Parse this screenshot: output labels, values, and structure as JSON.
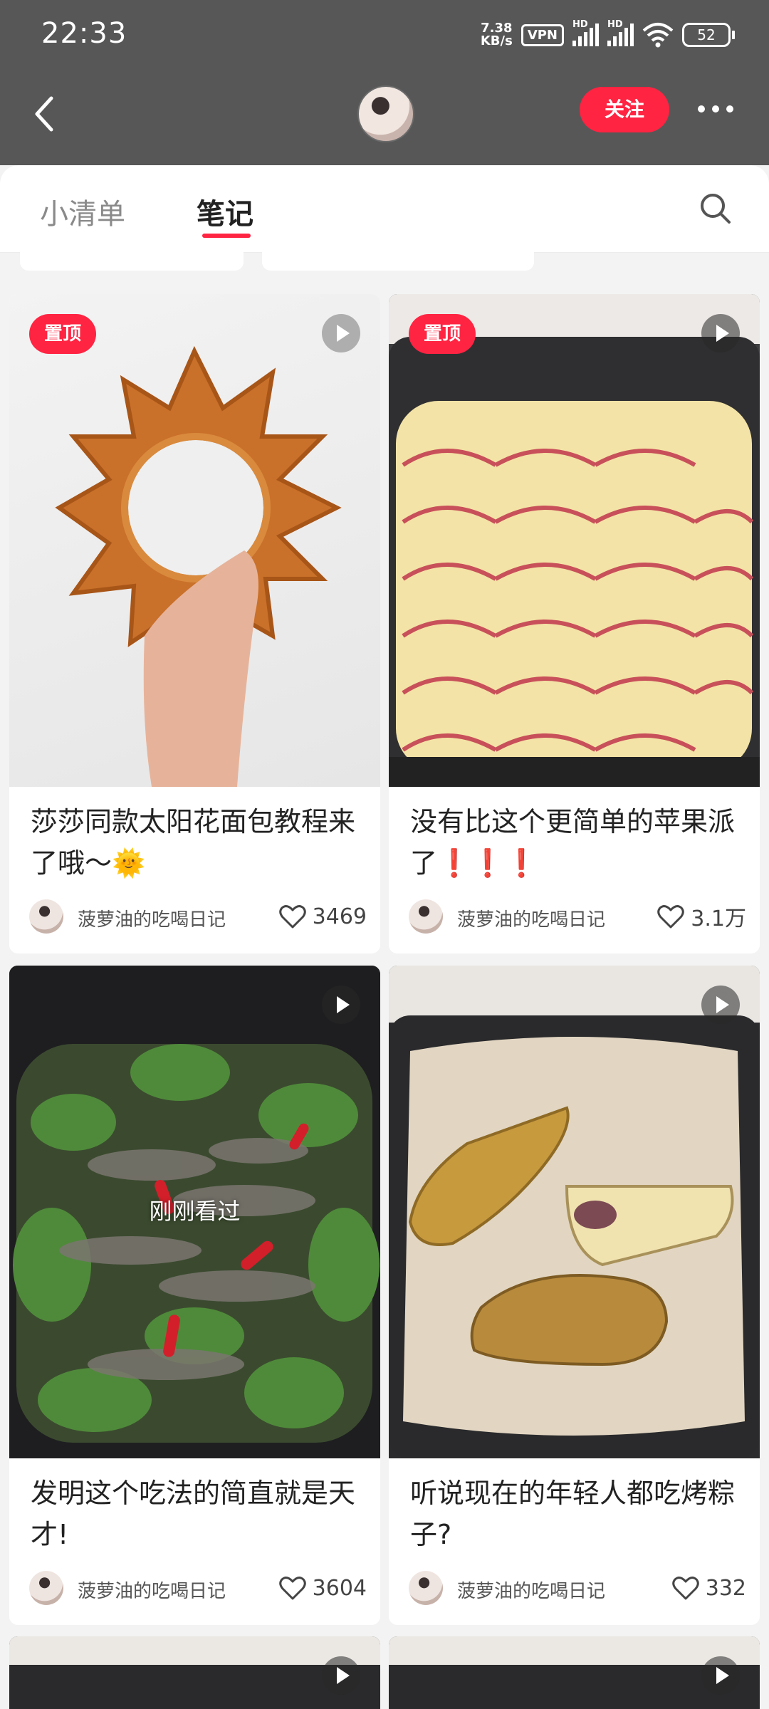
{
  "status": {
    "time": "22:33",
    "speed_top": "7.38",
    "speed_unit": "KB/s",
    "vpn": "VPN",
    "hd1": "HD",
    "hd2": "HD",
    "battery": "52"
  },
  "header": {
    "follow_label": "关注"
  },
  "tabs": [
    {
      "label": "小清单"
    },
    {
      "label": "笔记"
    }
  ],
  "notes": [
    {
      "pin": "置顶",
      "title": "莎莎同款太阳花面包教程来了哦～🌞",
      "author": "菠萝油的吃喝日记",
      "likes": "3469"
    },
    {
      "pin": "置顶",
      "title": "没有比这个更简单的苹果派了❗❗❗",
      "author": "菠萝油的吃喝日记",
      "likes": "3.1万"
    },
    {
      "seen": "刚刚看过",
      "title": "发明这个吃法的简直就是天才!",
      "author": "菠萝油的吃喝日记",
      "likes": "3604"
    },
    {
      "title": "听说现在的年轻人都吃烤粽子?",
      "author": "菠萝油的吃喝日记",
      "likes": "332"
    }
  ],
  "colors": {
    "accent": "#ff2442",
    "header_bg": "#575757",
    "page_bg": "#f3f3f3"
  },
  "icons": {
    "back": "chevron-left-icon",
    "more": "more-dots-icon",
    "search": "search-icon",
    "like": "heart-icon",
    "video": "play-icon"
  }
}
